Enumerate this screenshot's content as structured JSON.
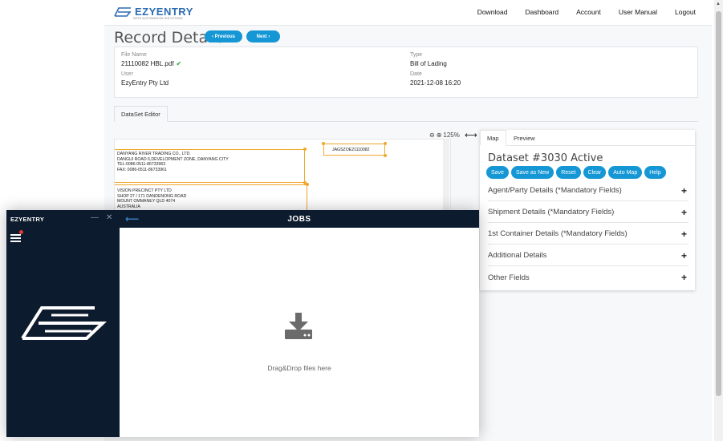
{
  "topnav": {
    "logo_text": "EZYENTRY",
    "logo_sub": "WITH AUTOMATION SOLUTIONS",
    "links": [
      "Download",
      "Dashboard",
      "Account",
      "User Manual",
      "Logout"
    ]
  },
  "record": {
    "title": "Record Details",
    "prev_label": "‹ Previous",
    "next_label": "Next ›",
    "file_name_label": "File Name",
    "file_name": "21110082 HBL.pdf",
    "type_label": "Type",
    "type": "Bill of Lading",
    "user_label": "User",
    "user": "EzyEntry Pty Ltd",
    "date_label": "Date",
    "date": "2021-12-08 16:20"
  },
  "editor": {
    "tab_label": "DataSet Editor",
    "zoom_level": "125%",
    "shipper_text": "DANYANG RIVER TRADING CO., LTD.\nDANGUI ROAD 6,DEVELOPMENT ZONE, DANYANG CITY\nTEL:0086-0511-86733963\nFAX: 0086-0511-86733961",
    "consignee_text": "VISION PRECINCT PTY LTD\nSHOP 27 / 171 DANDENONG ROAD\nMOUNT OMMANEY QLD 4074\nAUSTRALIA",
    "reference_no": "JAGSZOE21110082"
  },
  "map_panel": {
    "tabs": [
      "Map",
      "Preview"
    ],
    "dataset_title": "Dataset #3030 Active",
    "buttons": [
      "Save",
      "Save as New",
      "Reset",
      "Clear",
      "Auto Map",
      "Help"
    ],
    "sections": [
      "Agent/Party Details (*Mandatory Fields)",
      "Shipment Details (*Mandatory Fields)",
      "1st Container Details (*Mandatory Fields)",
      "Additional Details",
      "Other Fields"
    ]
  },
  "jobs_window": {
    "app_name": "EZYENTRY",
    "minimize": "—",
    "close": "✕",
    "title": "JOBS",
    "drop_text": "Drag&Drop files here"
  },
  "colors": {
    "accent_blue": "#1597d6",
    "navy": "#0d1b2e",
    "selection_orange": "#f0a82a",
    "check_green": "#2a9d3c"
  }
}
